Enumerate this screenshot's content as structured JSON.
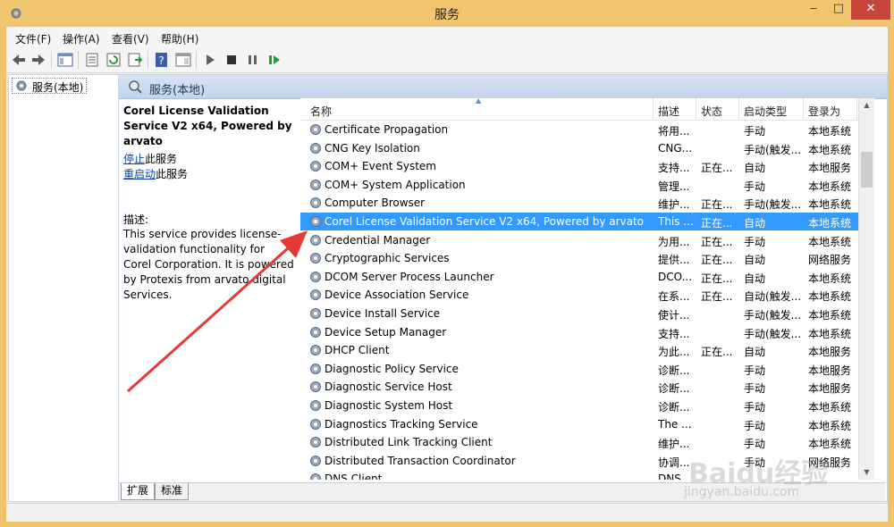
{
  "window": {
    "title": "服务"
  },
  "menu": [
    "文件(F)",
    "操作(A)",
    "查看(V)",
    "帮助(H)"
  ],
  "tree": {
    "root_label": "服务(本地)"
  },
  "pane_header": {
    "title": "服务(本地)"
  },
  "details": {
    "service_title": "Corel License Validation Service V2 x64, Powered by arvato",
    "stop_link": "停止",
    "stop_suffix": "此服务",
    "restart_link": "重启动",
    "restart_suffix": "此服务",
    "desc_label": "描述:",
    "desc_text": "This service provides license-validation functionality for Corel Corporation. It is powered by Protexis from arvato digital Services."
  },
  "columns": {
    "name": "名称",
    "desc": "描述",
    "state": "状态",
    "start": "启动类型",
    "logon": "登录为"
  },
  "services": [
    {
      "name": "Certificate Propagation",
      "desc": "将用...",
      "state": "",
      "start": "手动",
      "logon": "本地系统"
    },
    {
      "name": "CNG Key Isolation",
      "desc": "CNG...",
      "state": "",
      "start": "手动(触发...",
      "logon": "本地系统"
    },
    {
      "name": "COM+ Event System",
      "desc": "支持...",
      "state": "正在...",
      "start": "自动",
      "logon": "本地服务"
    },
    {
      "name": "COM+ System Application",
      "desc": "管理...",
      "state": "",
      "start": "手动",
      "logon": "本地系统"
    },
    {
      "name": "Computer Browser",
      "desc": "维护...",
      "state": "正在...",
      "start": "手动(触发...",
      "logon": "本地系统"
    },
    {
      "name": "Corel License Validation Service V2 x64, Powered by arvato",
      "desc": "This ...",
      "state": "正在...",
      "start": "自动",
      "logon": "本地系统",
      "selected": true
    },
    {
      "name": "Credential Manager",
      "desc": "为用...",
      "state": "正在...",
      "start": "手动",
      "logon": "本地系统"
    },
    {
      "name": "Cryptographic Services",
      "desc": "提供...",
      "state": "正在...",
      "start": "自动",
      "logon": "网络服务"
    },
    {
      "name": "DCOM Server Process Launcher",
      "desc": "DCO...",
      "state": "正在...",
      "start": "自动",
      "logon": "本地系统"
    },
    {
      "name": "Device Association Service",
      "desc": "在系...",
      "state": "正在...",
      "start": "自动(触发...",
      "logon": "本地系统"
    },
    {
      "name": "Device Install Service",
      "desc": "使计...",
      "state": "",
      "start": "手动(触发...",
      "logon": "本地系统"
    },
    {
      "name": "Device Setup Manager",
      "desc": "支持...",
      "state": "",
      "start": "手动(触发...",
      "logon": "本地系统"
    },
    {
      "name": "DHCP Client",
      "desc": "为此...",
      "state": "正在...",
      "start": "自动",
      "logon": "本地服务"
    },
    {
      "name": "Diagnostic Policy Service",
      "desc": "诊断...",
      "state": "",
      "start": "手动",
      "logon": "本地服务"
    },
    {
      "name": "Diagnostic Service Host",
      "desc": "诊断...",
      "state": "",
      "start": "手动",
      "logon": "本地服务"
    },
    {
      "name": "Diagnostic System Host",
      "desc": "诊断...",
      "state": "",
      "start": "手动",
      "logon": "本地系统"
    },
    {
      "name": "Diagnostics Tracking Service",
      "desc": "The ...",
      "state": "",
      "start": "手动",
      "logon": "本地系统"
    },
    {
      "name": "Distributed Link Tracking Client",
      "desc": "维护...",
      "state": "",
      "start": "手动",
      "logon": "本地系统"
    },
    {
      "name": "Distributed Transaction Coordinator",
      "desc": "协调...",
      "state": "",
      "start": "手动",
      "logon": "网络服务"
    },
    {
      "name": "DNS Client",
      "desc": "DNS ...",
      "state": "",
      "start": "",
      "logon": ""
    }
  ],
  "tabs": [
    "扩展",
    "标准"
  ],
  "watermark": {
    "brand": "Baidu经验",
    "url": "jingyan.baidu.com"
  },
  "colors": {
    "titlebar": "#f2c66f",
    "selection": "#3399ff",
    "close": "#c7463b",
    "arrow": "#e53935"
  }
}
